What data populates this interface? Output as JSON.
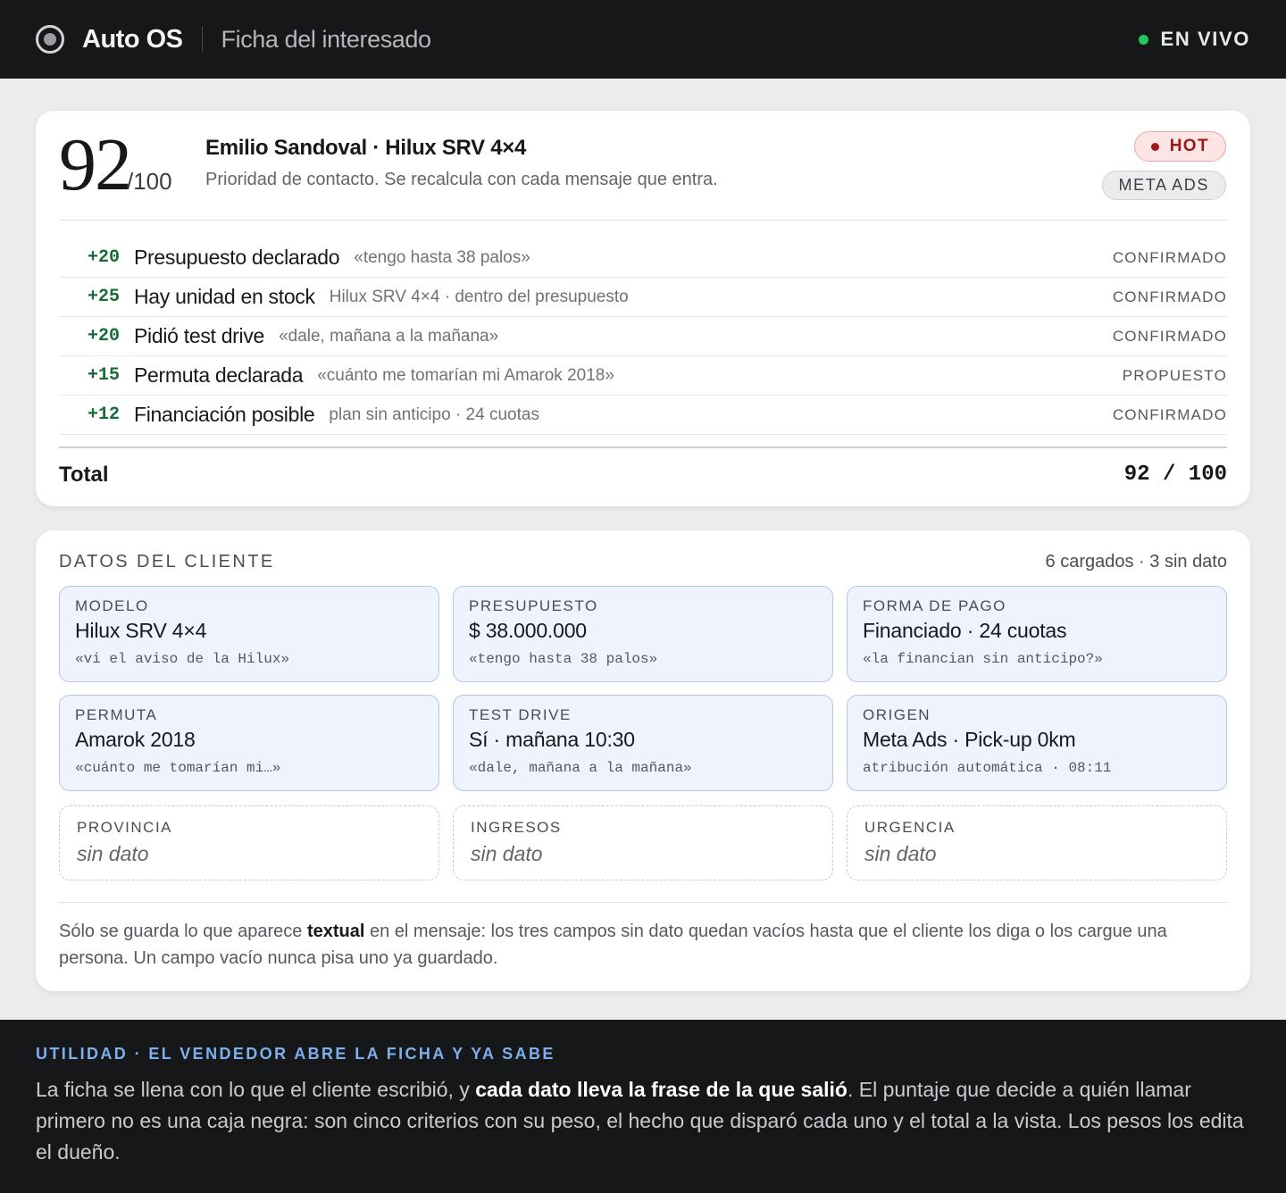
{
  "header": {
    "brand": "Auto OS",
    "subtitle": "Ficha del interesado",
    "live_label": "EN VIVO"
  },
  "score": {
    "value": "92",
    "denominator": "/100",
    "lead_name": "Emilio Sandoval · Hilux SRV 4×4",
    "description": "Prioridad de contacto. Se recalcula con cada mensaje que entra.",
    "temperature_badge": "HOT",
    "source_badge": "META ADS",
    "criteria": [
      {
        "points": "+20",
        "label": "Presupuesto declarado",
        "evidence": "«tengo hasta 38 palos»",
        "status": "CONFIRMADO"
      },
      {
        "points": "+25",
        "label": "Hay unidad en stock",
        "evidence": "Hilux SRV 4×4 · dentro del presupuesto",
        "status": "CONFIRMADO"
      },
      {
        "points": "+20",
        "label": "Pidió test drive",
        "evidence": "«dale, mañana a la mañana»",
        "status": "CONFIRMADO"
      },
      {
        "points": "+15",
        "label": "Permuta declarada",
        "evidence": "«cuánto me tomarían mi Amarok 2018»",
        "status": "PROPUESTO"
      },
      {
        "points": "+12",
        "label": "Financiación posible",
        "evidence": "plan sin anticipo · 24 cuotas",
        "status": "CONFIRMADO"
      }
    ],
    "total_label": "Total",
    "total_value": "92 / 100"
  },
  "client_data": {
    "title": "DATOS DEL CLIENTE",
    "count_summary": "6 cargados · 3 sin dato",
    "fields": [
      {
        "label": "MODELO",
        "value": "Hilux SRV 4×4",
        "quote": "«vi el aviso de la Hilux»"
      },
      {
        "label": "PRESUPUESTO",
        "value": "$ 38.000.000",
        "quote": "«tengo hasta 38 palos»"
      },
      {
        "label": "FORMA DE PAGO",
        "value": "Financiado · 24 cuotas",
        "quote": "«la financian sin anticipo?»"
      },
      {
        "label": "PERMUTA",
        "value": "Amarok 2018",
        "quote": "«cuánto me tomarían mi…»"
      },
      {
        "label": "TEST DRIVE",
        "value": "Sí · mañana 10:30",
        "quote": "«dale, mañana a la mañana»"
      },
      {
        "label": "ORIGEN",
        "value": "Meta Ads · Pick-up 0km",
        "quote": "atribución automática · 08:11"
      }
    ],
    "empty_fields": [
      {
        "label": "PROVINCIA",
        "value": "sin dato"
      },
      {
        "label": "INGRESOS",
        "value": "sin dato"
      },
      {
        "label": "URGENCIA",
        "value": "sin dato"
      }
    ],
    "note_before": "Sólo se guarda lo que aparece ",
    "note_bold": "textual",
    "note_after": " en el mensaje: los tres campos sin dato quedan vacíos hasta que el cliente los diga o los cargue una persona. Un campo vacío nunca pisa uno ya guardado."
  },
  "footer": {
    "kicker": "UTILIDAD · EL VENDEDOR ABRE LA FICHA Y YA SABE",
    "body_before": "La ficha se llena con lo que el cliente escribió, y ",
    "body_bold": "cada dato lleva la frase de la que salió",
    "body_after": ". El puntaje que decide a quién llamar primero no es una caja negra: son cinco criterios con su peso, el hecho que disparó cada uno y el total a la vista. Los pesos los edita el dueño."
  }
}
